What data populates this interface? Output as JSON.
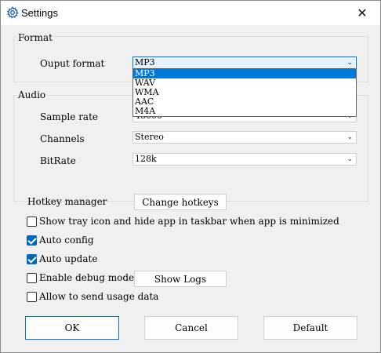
{
  "window": {
    "title": "Settings",
    "close_glyph": "✕"
  },
  "format_group": {
    "label": "Format",
    "output_format": {
      "label": "Ouput format",
      "value": "MP3",
      "options": [
        "MP3",
        "WAV",
        "WMA",
        "AAC",
        "M4A"
      ]
    }
  },
  "audio_group": {
    "label": "Audio",
    "sample_rate": {
      "label": "Sample rate",
      "value": "48000"
    },
    "channels": {
      "label": "Channels",
      "value": "Stereo"
    },
    "bitrate": {
      "label": "BitRate",
      "value": "128k"
    }
  },
  "hotkey": {
    "label": "Hotkey manager",
    "button": "Change hotkeys"
  },
  "options": {
    "tray": {
      "label": "Show tray icon and hide app in taskbar when app is minimized",
      "checked": false
    },
    "auto_config": {
      "label": "Auto config",
      "checked": true
    },
    "auto_update": {
      "label": "Auto update",
      "checked": true
    },
    "debug": {
      "label": "Enable debug mode",
      "checked": false,
      "button": "Show Logs"
    },
    "usage": {
      "label": "Allow to send usage data",
      "checked": false
    }
  },
  "footer": {
    "ok": "OK",
    "cancel": "Cancel",
    "default": "Default"
  },
  "icons": {
    "title_icon": "gear-icon",
    "combo_chevron": "chevron-down-icon"
  },
  "colors": {
    "accent": "#0078d7",
    "checkbox_checked": "#0067c0"
  }
}
